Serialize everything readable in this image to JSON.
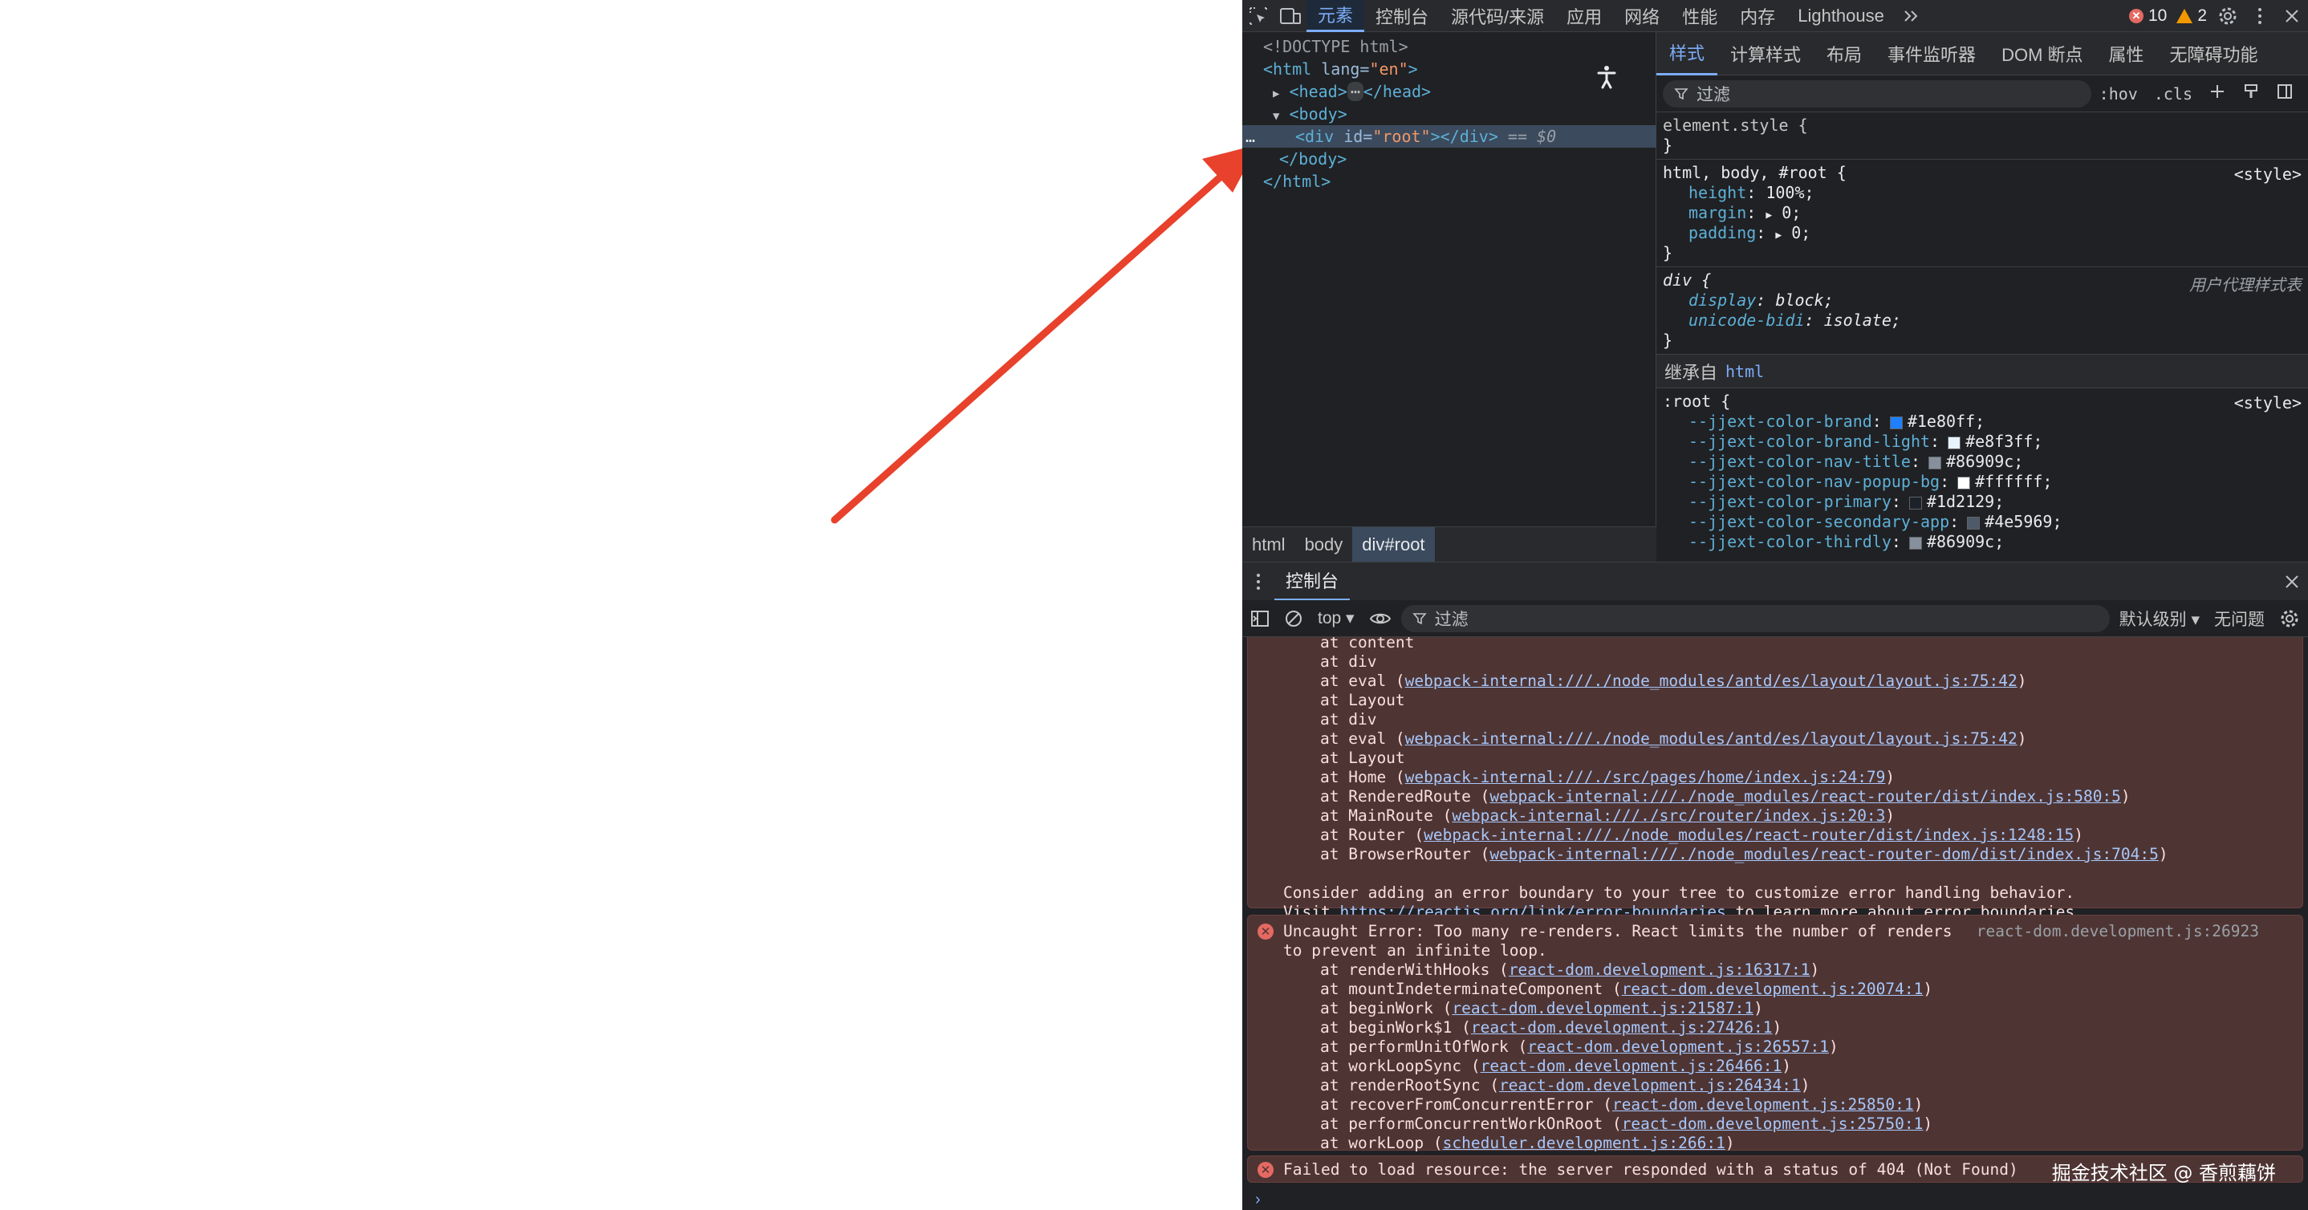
{
  "toolbar": {
    "tabs": [
      "元素",
      "控制台",
      "源代码/来源",
      "应用",
      "网络",
      "性能",
      "内存",
      "Lighthouse"
    ],
    "errors": "10",
    "warnings": "2",
    "colors": {
      "active": "#7cacf8",
      "error": "#e46962",
      "warning": "#f29900"
    }
  },
  "elements": {
    "doctype": "<!DOCTYPE html>",
    "html_open_tag": "<html",
    "html_attr": " lang=",
    "html_attr_val": "\"en\"",
    "html_close_bracket": ">",
    "head_open": "<head>",
    "head_ellipsis": "⋯",
    "head_close": "</head>",
    "body_open": "<body>",
    "div_open": "<div",
    "div_attr": " id=",
    "div_attr_val": "\"root\"",
    "div_close": "></div>",
    "div_eq": " == ",
    "div_dollar": "$0",
    "body_close": "</body>",
    "html_close": "</html>",
    "row_ellipsis": "…"
  },
  "breadcrumb": [
    "html",
    "body",
    "div#root"
  ],
  "styles": {
    "tabs": [
      "样式",
      "计算样式",
      "布局",
      "事件监听器",
      "DOM 断点",
      "属性",
      "无障碍功能"
    ],
    "filter_placeholder": "过滤",
    "hov": ":hov",
    "cls": ".cls",
    "element_style_selector": "element.style {",
    "close_brace": "}",
    "rule1": {
      "selector": "html, body, #root {",
      "source": "<style>",
      "props": [
        {
          "name": "height",
          "value": "100%;"
        },
        {
          "name": "margin",
          "value": "0;"
        },
        {
          "name": "padding",
          "value": "0;"
        }
      ]
    },
    "rule2": {
      "selector": "div {",
      "source": "用户代理样式表",
      "props": [
        {
          "name": "display",
          "value": "block;"
        },
        {
          "name": "unicode-bidi",
          "value": "isolate;"
        }
      ]
    },
    "inherited_label": "继承自",
    "inherited_from": "html",
    "root_rule": {
      "selector": ":root {",
      "source": "<style>",
      "vars": [
        {
          "name": "--jjext-color-brand",
          "value": "#1e80ff;",
          "color": "#1e80ff"
        },
        {
          "name": "--jjext-color-brand-light",
          "value": "#e8f3ff;",
          "color": "#e8f3ff"
        },
        {
          "name": "--jjext-color-nav-title",
          "value": "#86909c;",
          "color": "#86909c"
        },
        {
          "name": "--jjext-color-nav-popup-bg",
          "value": "#ffffff;",
          "color": "#ffffff"
        },
        {
          "name": "--jjext-color-primary",
          "value": "#1d2129;",
          "color": "#1d2129"
        },
        {
          "name": "--jjext-color-secondary-app",
          "value": "#4e5969;",
          "color": "#4e5969"
        },
        {
          "name": "--jjext-color-thirdly",
          "value": "#86909c;",
          "color": "#86909c"
        }
      ]
    }
  },
  "drawer": {
    "tab": "控制台",
    "context": "top ▾",
    "filter_placeholder": "过滤",
    "level": "默认级别 ▾",
    "issues": "无问题"
  },
  "console": {
    "msg1_lines": [
      {
        "text": "at content",
        "link": ""
      },
      {
        "text": "at div",
        "link": ""
      },
      {
        "text": "at eval (",
        "link": "webpack-internal:///./node_modules/antd/es/layout/layout.js:75:42",
        "after": ")"
      },
      {
        "text": "at Layout",
        "link": ""
      },
      {
        "text": "at div",
        "link": ""
      },
      {
        "text": "at eval (",
        "link": "webpack-internal:///./node_modules/antd/es/layout/layout.js:75:42",
        "after": ")"
      },
      {
        "text": "at Layout",
        "link": ""
      },
      {
        "text": "at Home (",
        "link": "webpack-internal:///./src/pages/home/index.js:24:79",
        "after": ")"
      },
      {
        "text": "at RenderedRoute (",
        "link": "webpack-internal:///./node_modules/react-router/dist/index.js:580:5",
        "after": ")"
      },
      {
        "text": "at MainRoute (",
        "link": "webpack-internal:///./src/router/index.js:20:3",
        "after": ")"
      },
      {
        "text": "at Router (",
        "link": "webpack-internal:///./node_modules/react-router/dist/index.js:1248:15",
        "after": ")"
      },
      {
        "text": "at BrowserRouter (",
        "link": "webpack-internal:///./node_modules/react-router-dom/dist/index.js:704:5",
        "after": ")"
      }
    ],
    "msg1_consider": "Consider adding an error boundary to your tree to customize error handling behavior.",
    "msg1_visit": "Visit ",
    "msg1_visit_link": "https://reactjs.org/link/error-boundaries",
    "msg1_visit_after": " to learn more about error boundaries.",
    "msg2_title": "Uncaught Error: Too many re-renders. React limits the number of renders",
    "msg2_title2": "to prevent an infinite loop.",
    "msg2_source": "react-dom.development.js:26923",
    "msg2_lines": [
      {
        "text": "at renderWithHooks (",
        "link": "react-dom.development.js:16317:1",
        "after": ")"
      },
      {
        "text": "at mountIndeterminateComponent (",
        "link": "react-dom.development.js:20074:1",
        "after": ")"
      },
      {
        "text": "at beginWork (",
        "link": "react-dom.development.js:21587:1",
        "after": ")"
      },
      {
        "text": "at beginWork$1 (",
        "link": "react-dom.development.js:27426:1",
        "after": ")"
      },
      {
        "text": "at performUnitOfWork (",
        "link": "react-dom.development.js:26557:1",
        "after": ")"
      },
      {
        "text": "at workLoopSync (",
        "link": "react-dom.development.js:26466:1",
        "after": ")"
      },
      {
        "text": "at renderRootSync (",
        "link": "react-dom.development.js:26434:1",
        "after": ")"
      },
      {
        "text": "at recoverFromConcurrentError (",
        "link": "react-dom.development.js:25850:1",
        "after": ")"
      },
      {
        "text": "at performConcurrentWorkOnRoot (",
        "link": "react-dom.development.js:25750:1",
        "after": ")"
      },
      {
        "text": "at workLoop (",
        "link": "scheduler.development.js:266:1",
        "after": ")"
      }
    ],
    "msg3_text": "Failed to load resource: the server responded with a status of 404 (Not Found)",
    "prompt": "›",
    "watermark": "掘金技术社区 @ 香煎藕饼"
  }
}
